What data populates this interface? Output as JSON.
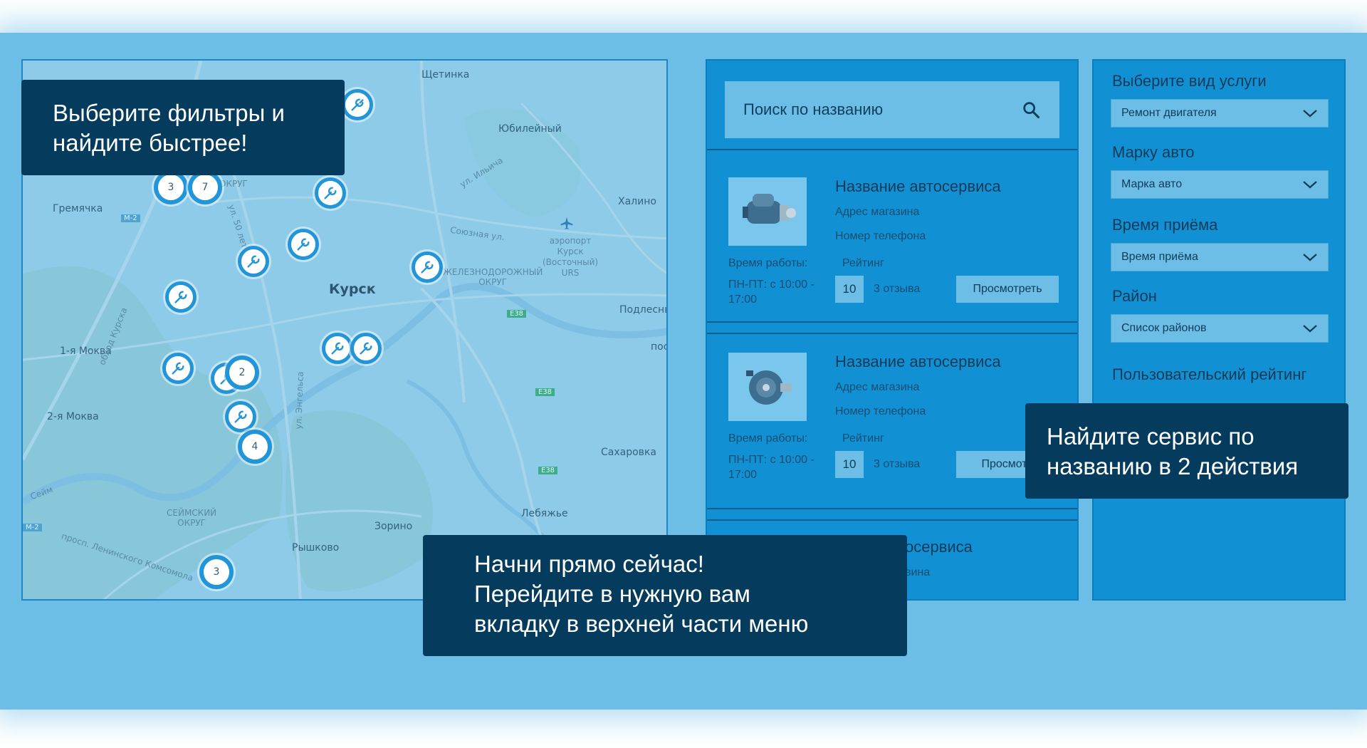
{
  "map": {
    "labels": {
      "shchetinka": "Щетинка",
      "yubileyny": "Юбилейный",
      "gremyachka": "Гремячка",
      "khalino": "Халино",
      "kursk": "Курск",
      "airport": "аэропорт\nКурск\n(Восточный)\nURS",
      "podlesnaya": "Подлесны",
      "moskva1": "1-я Моква",
      "moskva2": "2-я Моква",
      "sakharovka": "Сахаровка",
      "lebyazhye": "Лебяжье",
      "zorino": "Зорино",
      "ryshkovo": "Рышково",
      "seymsky": "СЕЙМСКИЙ\nОКРУГ",
      "zheleznodorozhny": "ЖЕЛЕЗНОДОРОЖНЫЙ\nОКРУГ",
      "soyuznaya": "Союзная ул.",
      "ilyicha": "ул. Ильича",
      "leninsky": "просп. Ленинского Комсомола",
      "obhod": "обход Курска",
      "ul50let": "ул. 50 лет О",
      "engelsa": "ул. Энгельса",
      "road_m2": "М-2",
      "road_e38": "E38",
      "sejm": "Сейм",
      "okrug": "ОКРУГ",
      "pos": "пос"
    },
    "clusters": [
      "3",
      "7",
      "2",
      "4",
      "3"
    ]
  },
  "search": {
    "placeholder": "Поиск по названию",
    "icon": "search-icon"
  },
  "cards": [
    {
      "title": "Название автосервиса",
      "address": "Адрес магазина",
      "phone": "Номер телефона",
      "hours_label": "Время работы:",
      "rating_label": "Рейтинг",
      "hours": "ПН-ПТ: с 10:00 - 17:00",
      "score": "10",
      "reviews": "3 отзыва",
      "view": "Просмотреть"
    },
    {
      "title": "Название автосервиса",
      "address": "Адрес магазина",
      "phone": "Номер телефона",
      "hours_label": "Время работы:",
      "rating_label": "Рейтинг",
      "hours": "ПН-ПТ: с 10:00 - 17:00",
      "score": "10",
      "reviews": "3 отзыва",
      "view": "Просмотр"
    },
    {
      "title": "осервиса",
      "address": "вина"
    }
  ],
  "filters": {
    "service_label": "Выберите вид услуги",
    "service_value": "Ремонт двигателя",
    "brand_label": "Марку авто",
    "brand_value": "Марка авто",
    "time_label": "Время приёма",
    "time_value": "Время приёма",
    "district_label": "Район",
    "district_value": "Список районов",
    "rating_label": "Пользовательский рейтинг"
  },
  "callouts": {
    "filters": [
      "Выберите фильтры и",
      "найдите быстрее!"
    ],
    "search": [
      "Найдите сервис по",
      "названию в 2 действия"
    ],
    "start": [
      "Начни прямо сейчас!",
      "Перейдите в нужную вам",
      "вкладку в верхней части меню"
    ]
  },
  "colors": {
    "band": "#6cbee6",
    "panel": "#1191d3",
    "callout": "#053c5e",
    "marker": "#2295d8"
  }
}
